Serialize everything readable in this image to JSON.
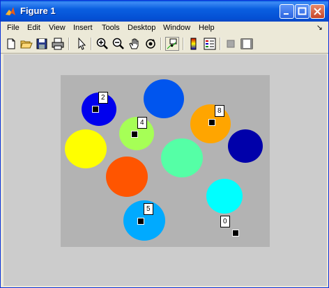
{
  "window": {
    "title": "Figure 1"
  },
  "menu": [
    "File",
    "Edit",
    "View",
    "Insert",
    "Tools",
    "Desktop",
    "Window",
    "Help"
  ],
  "menu_arrow": "↘",
  "toolbar": {
    "tools": [
      "new-figure-icon",
      "open-file-icon",
      "save-icon",
      "print-icon",
      "edit-plot-arrow-icon",
      "zoom-in-icon",
      "zoom-out-icon",
      "pan-hand-icon",
      "rotate-3d-icon",
      "data-cursor-icon",
      "colorbar-icon",
      "legend-icon",
      "hide-plot-tools-icon",
      "show-plot-tools-icon"
    ]
  },
  "colors": {
    "axes_bg": "#b3b3b3",
    "figure_bg": "#cccccc"
  },
  "circles": [
    {
      "name": "blue",
      "color": "#0000ee"
    },
    {
      "name": "royal-blue",
      "color": "#0055ee"
    },
    {
      "name": "yellow",
      "color": "#ffff00"
    },
    {
      "name": "light-green",
      "color": "#a6ff56"
    },
    {
      "name": "orange",
      "color": "#ffa500"
    },
    {
      "name": "navy",
      "color": "#0000aa"
    },
    {
      "name": "aquamarine",
      "color": "#55ffa6"
    },
    {
      "name": "red-orange",
      "color": "#ff5500"
    },
    {
      "name": "cyan",
      "color": "#00ffff"
    },
    {
      "name": "sky-blue",
      "color": "#00aaff"
    }
  ],
  "datatips": [
    {
      "label": "2"
    },
    {
      "label": "4"
    },
    {
      "label": "8"
    },
    {
      "label": "5"
    },
    {
      "label": "0"
    }
  ]
}
